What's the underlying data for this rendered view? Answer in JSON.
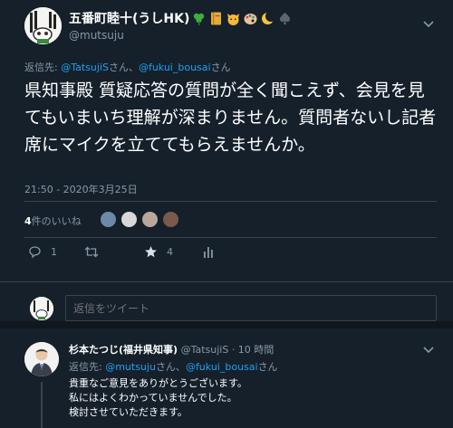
{
  "main_tweet": {
    "display_name": "五番町睦十(うしHK)",
    "emojis": [
      "shamrock-emoji",
      "notebook-emoji",
      "cat-emoji",
      "palette-emoji",
      "crescent-moon-emoji",
      "spade-emoji"
    ],
    "handle": "@mutsuju",
    "reply_to": {
      "prefix": "返信先: ",
      "mention1": "@TatsujiS",
      "mid": "さん、",
      "mention2": "@fukui_bousai",
      "suffix": "さん"
    },
    "text": "県知事殿 質疑応答の質問が全く聞こえず、会見を見てもいまいち理解が深まりません。質問者ないし記者席にマイクを立ててもらえませんか。",
    "timestamp": "21:50 - 2020年3月25日",
    "likes": {
      "count": "4",
      "label": "件のいいね"
    },
    "liker_avatar_colors": [
      "#6c8aa8",
      "#d8d8d8",
      "#b9a89a",
      "#7a5a4a"
    ],
    "actions": {
      "reply_count": "1",
      "retweet_count": "",
      "like_count": "4"
    }
  },
  "composer": {
    "placeholder": "返信をツイート"
  },
  "reply_tweet": {
    "display_name": "杉本たつじ(福井県知事)",
    "handle": "@TatsujiS",
    "time": "· 10 時間",
    "reply_to": {
      "prefix": "返信先: ",
      "mention1": "@mutsuju",
      "mid": "さん、",
      "mention2": "@fukui_bousai",
      "suffix": "さん"
    },
    "lines": [
      "貴重なご意見をありがとうございます。",
      "私にはよくわかっていませんでした。",
      "検討させていただきます。"
    ]
  },
  "colors": {
    "background": "#15202b",
    "secondary_text": "#8899a6",
    "accent": "#1da1f2",
    "divider": "#38444d"
  }
}
